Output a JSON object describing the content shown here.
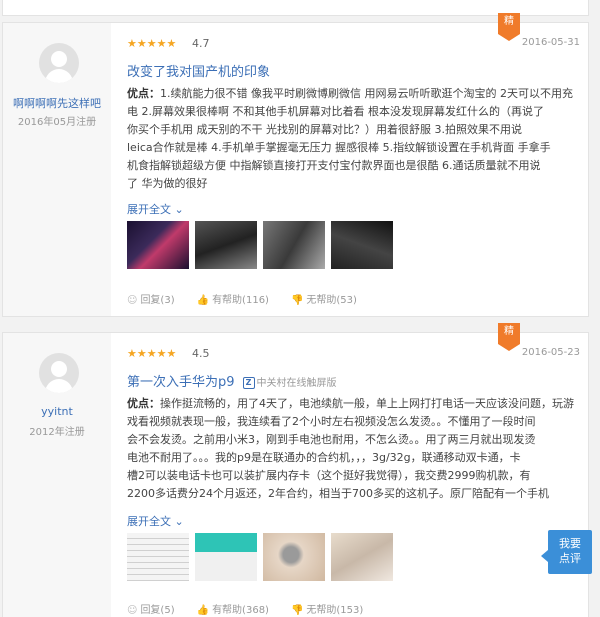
{
  "reviews": [
    {
      "user": {
        "name": "啊啊啊啊先这样吧",
        "registered": "2016年05月注册"
      },
      "stars": "★★★★★",
      "score": "4.7",
      "badge": "精",
      "date": "2016-05-31",
      "title": "改变了我对国产机的印象",
      "source": "",
      "pros_label": "优点：",
      "pros_lines": [
        "1.续航能力很不错 像我平时刷微博刷微信 用网易云听听歌逛个淘宝的 2天可以不用充",
        "电 2.屏幕效果很棒啊 不和其他手机屏幕对比着看 根本没发现屏幕发红什么的（再说了",
        "你买个手机用 成天别的不干 光找别的屏幕对比？）用着很舒服 3.拍照效果不用说",
        "leica合作就是棒 4.手机单手掌握毫无压力 握感很棒 5.指纹解锁设置在手机背面 手拿手",
        "机食指解锁超级方便 中指解锁直接打开支付宝付款界面也是很酷 6.通话质量就不用说",
        "了 华为做的很好"
      ],
      "expand": "展开全文",
      "actions": {
        "reply": "回复(3)",
        "useful": "有帮助(116)",
        "useless": "无帮助(53)"
      },
      "thumbs": [
        "#1a1030",
        "#2a2a2a",
        "#3a3a3a",
        "#222222"
      ]
    },
    {
      "user": {
        "name": "yyitnt",
        "registered": "2012年注册"
      },
      "stars": "★★★★★",
      "score": "4.5",
      "badge": "精",
      "date": "2016-05-23",
      "title": "第一次入手华为p9",
      "source": "中关村在线触屏版",
      "source_icon": "Z",
      "pros_label": "优点：",
      "pros_lines": [
        "操作挺流畅的，用了4天了，电池续航一般，单上上网打打电话一天应该没问题，玩游",
        "戏看视频就表现一般，我连续看了2个小时左右视频没怎么发烫。。不懂用了一段时间",
        "会不会发烫。之前用小米3，刚到手电池也耐用，不怎么烫。。用了两三月就出现发烫",
        "电池不耐用了。。。我的p9是在联通办的合约机，，，3g/32g，联通移动双卡通，卡",
        "槽2可以装电话卡也可以装扩展内存卡（这个挺好我觉得），我交费2999购机款，有",
        "2200多话费分24个月返还，2年合约，相当于700多买的这机子。原厂陪配有一个手机"
      ],
      "expand": "展开全文",
      "actions": {
        "reply": "回复(5)",
        "useful": "有帮助(368)",
        "useless": "无帮助(153)"
      },
      "thumbs": [
        "#e8e8e8",
        "#2ec4b6",
        "#d8c8b8",
        "#e0d0c0"
      ]
    }
  ],
  "fab": {
    "line1": "我要",
    "line2": "点评"
  }
}
